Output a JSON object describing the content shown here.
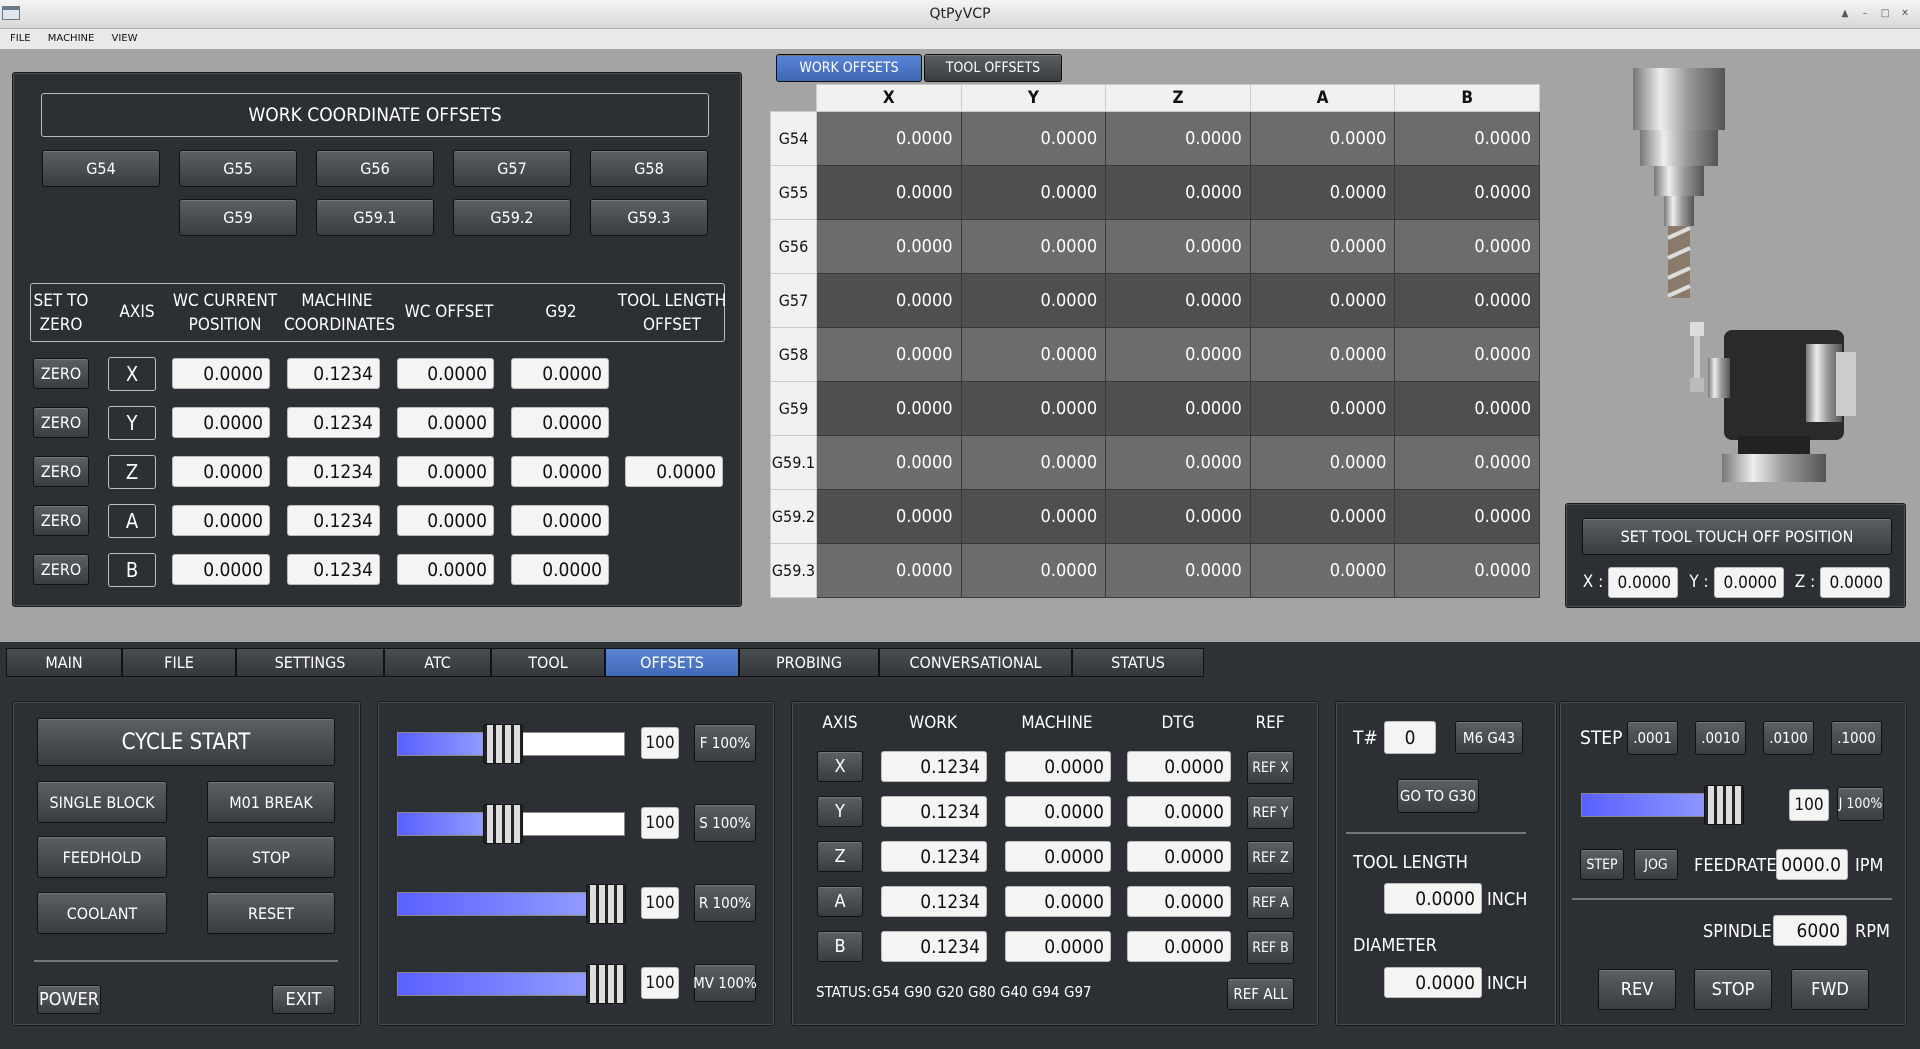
{
  "window": {
    "title": "QtPyVCP"
  },
  "menu": [
    "FILE",
    "MACHINE",
    "VIEW"
  ],
  "wco": {
    "title": "WORK COORDINATE OFFSETS",
    "row1": [
      "G54",
      "G55",
      "G56",
      "G57",
      "G58"
    ],
    "row2": [
      "G59",
      "G59.1",
      "G59.2",
      "G59.3"
    ],
    "headers": [
      [
        "SET TO",
        "ZERO"
      ],
      [
        "AXIS"
      ],
      [
        "WC CURRENT",
        "POSITION"
      ],
      [
        "MACHINE",
        "COORDINATES"
      ],
      [
        "WC OFFSET"
      ],
      [
        "G92"
      ],
      [
        "TOOL LENGTH",
        "OFFSET"
      ]
    ],
    "zero_label": "ZERO",
    "rows": [
      {
        "axis": "X",
        "wc": "0.0000",
        "mach": "0.1234",
        "off": "0.0000",
        "g92": "0.0000"
      },
      {
        "axis": "Y",
        "wc": "0.0000",
        "mach": "0.1234",
        "off": "0.0000",
        "g92": "0.0000"
      },
      {
        "axis": "Z",
        "wc": "0.0000",
        "mach": "0.1234",
        "off": "0.0000",
        "g92": "0.0000",
        "tlo": "0.0000"
      },
      {
        "axis": "A",
        "wc": "0.0000",
        "mach": "0.1234",
        "off": "0.0000",
        "g92": "0.0000"
      },
      {
        "axis": "B",
        "wc": "0.0000",
        "mach": "0.1234",
        "off": "0.0000",
        "g92": "0.0000"
      }
    ]
  },
  "offset_tabs": [
    "WORK OFFSETS",
    "TOOL OFFSETS"
  ],
  "offset_table": {
    "columns": [
      "X",
      "Y",
      "Z",
      "A",
      "B"
    ],
    "rows": [
      {
        "name": "G54",
        "vals": [
          "0.0000",
          "0.0000",
          "0.0000",
          "0.0000",
          "0.0000"
        ]
      },
      {
        "name": "G55",
        "vals": [
          "0.0000",
          "0.0000",
          "0.0000",
          "0.0000",
          "0.0000"
        ]
      },
      {
        "name": "G56",
        "vals": [
          "0.0000",
          "0.0000",
          "0.0000",
          "0.0000",
          "0.0000"
        ]
      },
      {
        "name": "G57",
        "vals": [
          "0.0000",
          "0.0000",
          "0.0000",
          "0.0000",
          "0.0000"
        ]
      },
      {
        "name": "G58",
        "vals": [
          "0.0000",
          "0.0000",
          "0.0000",
          "0.0000",
          "0.0000"
        ]
      },
      {
        "name": "G59",
        "vals": [
          "0.0000",
          "0.0000",
          "0.0000",
          "0.0000",
          "0.0000"
        ]
      },
      {
        "name": "G59.1",
        "vals": [
          "0.0000",
          "0.0000",
          "0.0000",
          "0.0000",
          "0.0000"
        ]
      },
      {
        "name": "G59.2",
        "vals": [
          "0.0000",
          "0.0000",
          "0.0000",
          "0.0000",
          "0.0000"
        ]
      },
      {
        "name": "G59.3",
        "vals": [
          "0.0000",
          "0.0000",
          "0.0000",
          "0.0000",
          "0.0000"
        ]
      }
    ]
  },
  "touch_off": {
    "button": "SET TOOL TOUCH OFF POSITION",
    "x_label": "X :",
    "x": "0.0000",
    "y_label": "Y :",
    "y": "0.0000",
    "z_label": "Z :",
    "z": "0.0000"
  },
  "main_tabs": [
    "MAIN",
    "FILE",
    "SETTINGS",
    "ATC",
    "TOOL",
    "OFFSETS",
    "PROBING",
    "CONVERSATIONAL",
    "STATUS"
  ],
  "main_tab_active": 5,
  "controls": {
    "cycle_start": "CYCLE START",
    "single_block": "SINGLE BLOCK",
    "m01_break": "M01 BREAK",
    "feedhold": "FEEDHOLD",
    "stop": "STOP",
    "coolant": "COOLANT",
    "reset": "RESET",
    "power": "POWER",
    "exit": "EXIT"
  },
  "overrides": [
    {
      "value": "100",
      "button": "F 100%",
      "level": 0.45
    },
    {
      "value": "100",
      "button": "S 100%",
      "level": 0.45
    },
    {
      "value": "100",
      "button": "R 100%",
      "level": 1.0
    },
    {
      "value": "100",
      "button": "MV 100%",
      "level": 1.0
    }
  ],
  "dro": {
    "headers": [
      "AXIS",
      "WORK",
      "MACHINE",
      "DTG",
      "REF"
    ],
    "rows": [
      {
        "axis": "X",
        "work": "0.1234",
        "mach": "0.0000",
        "dtg": "0.0000",
        "ref": "REF X"
      },
      {
        "axis": "Y",
        "work": "0.1234",
        "mach": "0.0000",
        "dtg": "0.0000",
        "ref": "REF Y"
      },
      {
        "axis": "Z",
        "work": "0.1234",
        "mach": "0.0000",
        "dtg": "0.0000",
        "ref": "REF Z"
      },
      {
        "axis": "A",
        "work": "0.1234",
        "mach": "0.0000",
        "dtg": "0.0000",
        "ref": "REF A"
      },
      {
        "axis": "B",
        "work": "0.1234",
        "mach": "0.0000",
        "dtg": "0.0000",
        "ref": "REF B"
      }
    ],
    "status_label": "STATUS:",
    "status_codes": [
      "G54",
      "G90",
      "G20",
      "G80",
      "G40",
      "G94",
      "G97"
    ],
    "ref_all": "REF ALL"
  },
  "tool": {
    "t_label": "T#",
    "t_value": "0",
    "m6": "M6 G43",
    "go_g30": "GO TO G30",
    "length_label": "TOOL LENGTH",
    "length": "0.0000",
    "length_unit": "INCH",
    "diameter_label": "DIAMETER",
    "diameter": "0.0000",
    "diameter_unit": "INCH"
  },
  "jog": {
    "step_label": "STEP",
    "steps": [
      ".0001",
      ".0010",
      ".0100",
      ".1000"
    ],
    "value": "100",
    "jog_pct": "J 100%",
    "level": 1.0,
    "step_btn": "STEP",
    "jog_btn": "JOG",
    "feedrate_label": "FEEDRATE",
    "feedrate": "0000.0",
    "feed_unit": "IPM",
    "spindle_label": "SPINDLE",
    "spindle": "6000",
    "spindle_unit": "RPM",
    "rev": "REV",
    "stop": "STOP",
    "fwd": "FWD"
  }
}
